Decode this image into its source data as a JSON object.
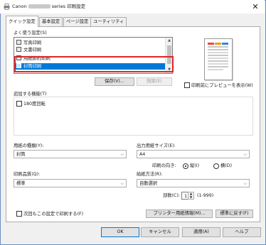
{
  "window": {
    "title_prefix": "Canon",
    "title_suffix": "series 印刷設定",
    "close": "✕"
  },
  "tabs": [
    "クイック設定",
    "基本設定",
    "ページ設定",
    "ユーティリティ"
  ],
  "favorites": {
    "label": "よく使う設定(S)",
    "items": [
      "写真印刷",
      "文書印刷",
      "用紙節約印刷",
      "封筒印刷"
    ],
    "selected_index": 3,
    "save_button": "保存(V)...",
    "delete_button": "削除(E)"
  },
  "preview_checkbox": {
    "label": "印刷前にプレビューを表示(W)",
    "checked": false
  },
  "additional": {
    "label": "追加する機能(T)",
    "rotate_checkbox": {
      "label": "180度回転",
      "checked": false
    }
  },
  "media_type": {
    "label": "用紙の種類(Y):",
    "value": "封筒"
  },
  "printer_paper_size": {
    "label": "出力用紙サイズ(E):",
    "value": "A4"
  },
  "orientation": {
    "label": "印刷の向き:",
    "portrait": "縦(I)",
    "landscape": "横(D)",
    "selected": "portrait"
  },
  "print_quality": {
    "label": "印刷品質(Q):",
    "value": "標準"
  },
  "paper_source": {
    "label": "給紙方法(R):",
    "value": "自動選択"
  },
  "copies": {
    "label": "部数(C):",
    "value": "1",
    "range": "(1-999)"
  },
  "always_print_checkbox": {
    "label": "次回もこの設定で印刷する(F)",
    "checked": false
  },
  "printer_media_info_button": "プリンター用紙情報(M)...",
  "defaults_button": "標準に戻す(F)",
  "footer": {
    "ok": "OK",
    "cancel": "キャンセル",
    "apply": "適用(A)",
    "help": "ヘルプ"
  },
  "colors": {
    "selection": "#0078d7",
    "highlight_box": "#e0242b"
  }
}
